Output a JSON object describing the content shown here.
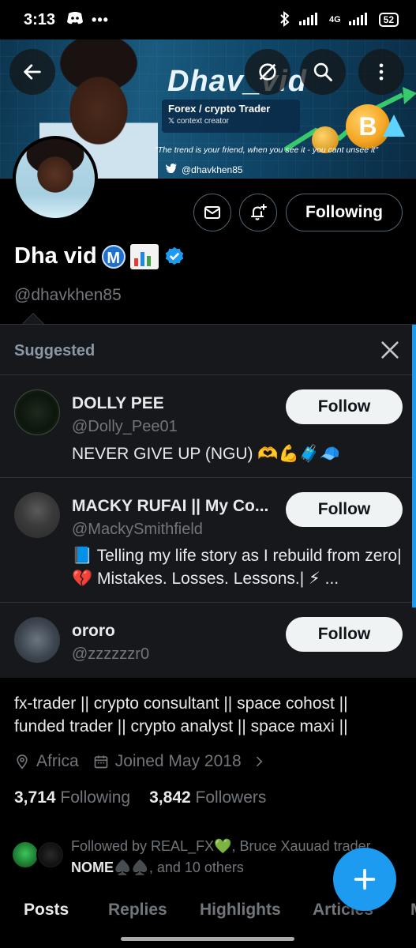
{
  "status_bar": {
    "time": "3:13",
    "network": "4G",
    "battery": "52"
  },
  "banner": {
    "title": "Dhav_vid",
    "subtitle": "Forex / crypto Trader",
    "subtitle2": "context creator",
    "quote": "\"The trend is your friend, when you see it - you cant unsee it\"",
    "handle": "@dhavkhen85",
    "coin_symbol": "B"
  },
  "profile": {
    "display_name": "Dha vid",
    "m_badge": "M",
    "handle": "@dhavkhen85",
    "following_button": "Following",
    "bio_line1": "fx-trader || crypto consultant || space cohost ||",
    "bio_line2": "funded trader || crypto analyst || space maxi ||",
    "location": "Africa",
    "joined": "Joined May 2018",
    "following_count": "3,714",
    "following_label": "Following",
    "followers_count": "3,842",
    "followers_label": "Followers",
    "followed_by_prefix": "Followed by REAL_FX💚, Bruce Xauuad trader,",
    "followed_by_bold": "NOME♠️♠️",
    "followed_by_suffix": ", and 10 others"
  },
  "suggested": {
    "heading": "Suggested",
    "users": [
      {
        "name": "DOLLY PEE",
        "handle": "@Dolly_Pee01",
        "bio": "NEVER GIVE UP (NGU) 🫶💪🧳🧢",
        "button": "Follow"
      },
      {
        "name": "MACKY RUFAI || My Co...",
        "handle": "@MackySmithfield",
        "bio": "📘 Telling my life story as I rebuild from zero| 💔 Mistakes. Losses. Lessons.| ⚡ ...",
        "button": "Follow"
      },
      {
        "name": "ororo",
        "handle": "@zzzzzzr0",
        "bio": "",
        "button": "Follow"
      }
    ]
  },
  "tabs": [
    "Posts",
    "Replies",
    "Highlights",
    "Articles",
    "M"
  ],
  "colors": {
    "accent": "#1d9bf0",
    "background": "#000000",
    "panel": "#16181c",
    "muted": "#71767b"
  },
  "icons": [
    "back-arrow-icon",
    "no-sign-icon",
    "search-icon",
    "more-vertical-icon",
    "mail-icon",
    "bell-plus-icon",
    "verified-icon",
    "close-icon",
    "location-icon",
    "calendar-icon",
    "chevron-right-icon",
    "plus-icon"
  ]
}
